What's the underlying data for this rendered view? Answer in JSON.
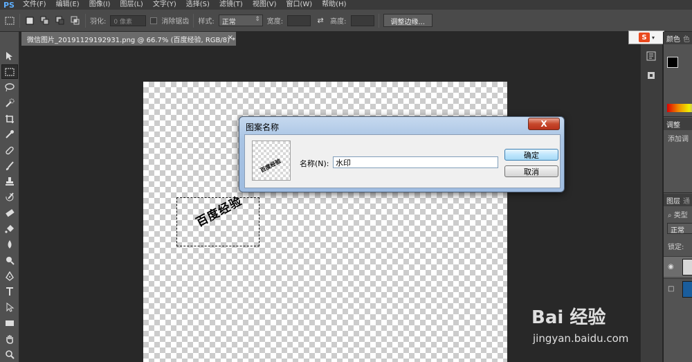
{
  "app": {
    "logo": "PS"
  },
  "menu": [
    "文件(F)",
    "编辑(E)",
    "图像(I)",
    "图层(L)",
    "文字(Y)",
    "选择(S)",
    "滤镜(T)",
    "视图(V)",
    "窗口(W)",
    "帮助(H)"
  ],
  "options": {
    "feather_label": "羽化:",
    "feather_value": "0 像素",
    "antialias_label": "消除锯齿",
    "style_label": "样式:",
    "style_value": "正常",
    "width_label": "宽度:",
    "height_label": "高度:",
    "refine_edge_button": "调整边缘..."
  },
  "document": {
    "tab_title": "微信图片_20191129192931.png @ 66.7% (百度经验, RGB/8) *",
    "close": "×",
    "watermark_text": "百度经验"
  },
  "sogou": {
    "logo": "S"
  },
  "panels": {
    "color_tab": "颜色",
    "color_tab2": "色",
    "adjust_tab": "调整",
    "adjust_hint": "添加调",
    "layers_tab": "图层",
    "layers_tab2": "通",
    "kind_label": "类型",
    "blend_mode": "正常",
    "lock_label": "锁定:"
  },
  "dialog": {
    "title": "图案名称",
    "close": "X",
    "name_label": "名称(N):",
    "name_value": "水印",
    "ok_button": "确定",
    "cancel_button": "取消",
    "preview_text": "百度经验"
  },
  "branding": {
    "baidu_logo": "Bai 经验",
    "url": "jingyan.baidu.com"
  },
  "colors": {
    "ui_dark": "#282828",
    "dialog_title_blue": "#a9c4e4",
    "close_red": "#c7482c"
  }
}
